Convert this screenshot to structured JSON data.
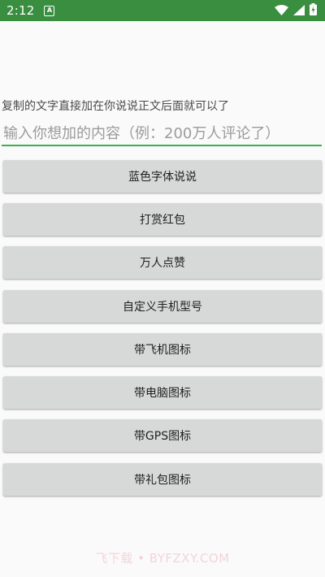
{
  "status_bar": {
    "time": "2:12",
    "notification_glyph": "A",
    "icons": [
      "wifi-icon",
      "signal-icon",
      "battery-icon"
    ],
    "background": "#3a8e3f"
  },
  "hint_text": "复制的文字直接加在你说说正文后面就可以了",
  "input": {
    "value": "",
    "placeholder": "输入你想加的内容（例：200万人评论了）",
    "underline_color": "#3fae4f"
  },
  "buttons": [
    {
      "label": "蓝色字体说说"
    },
    {
      "label": "打赏红包"
    },
    {
      "label": "万人点赞"
    },
    {
      "label": "自定义手机型号"
    },
    {
      "label": "带飞机图标"
    },
    {
      "label": "带电脑图标"
    },
    {
      "label": "带GPS图标"
    },
    {
      "label": "带礼包图标"
    }
  ],
  "watermark": "飞下载 • BYFZXY.COM"
}
